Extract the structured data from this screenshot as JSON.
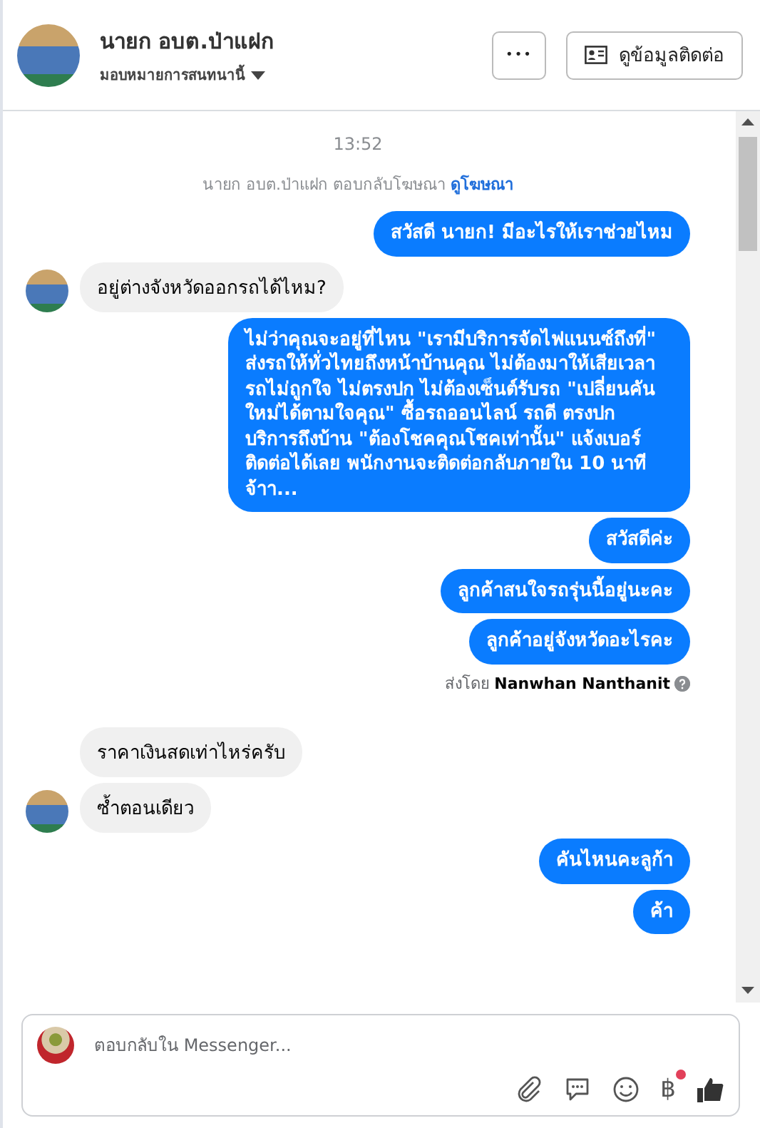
{
  "header": {
    "name": "นายก อบต.ป่าแฝก",
    "subtitle": "มอบหมายการสนทนานี้",
    "more_button": "•••",
    "contact_button": "ดูข้อมูลติดต่อ"
  },
  "messages": [
    {
      "kind": "timestamp",
      "text": "13:52"
    },
    {
      "kind": "notice",
      "text": "นายก อบต.ป่าแฝก ตอบกลับโฆษณา",
      "link": "ดูโฆษณา"
    },
    {
      "kind": "outgoing",
      "text": "สวัสดี นายก! มีอะไรให้เราช่วยไหม"
    },
    {
      "kind": "incoming",
      "text": "อยู่ต่างจังหวัดออกรถได้ไหม?",
      "avatar": true
    },
    {
      "kind": "outgoing",
      "text": "ไม่ว่าคุณจะอยู่ที่ไหน \"เรามีบริการจัดไฟแนนซ์ถึงที่\" ส่งรถให้ทั่วไทยถึงหน้าบ้านคุณ ไม่ต้องมาให้เสียเวลา รถไม่ถูกใจ ไม่ตรงปก ไม่ต้องเซ็นต์รับรถ \"เปลี่ยนคันใหม่ได้ตามใจคุณ\" ซื้อรถออนไลน์ รถดี ตรงปก บริการถึงบ้าน \"ต้องโชคคุณโชคเท่านั้น\" แจ้งเบอร์ ติดต่อได้เลย พนักงานจะติดต่อกลับภายใน 10 นาที จ้าา..."
    },
    {
      "kind": "outgoing",
      "text": "สวัสดีค่ะ"
    },
    {
      "kind": "outgoing",
      "text": "ลูกค้าสนใจรถรุ่นนี้อยู่นะคะ"
    },
    {
      "kind": "outgoing",
      "text": "ลูกค้าอยู่จังหวัดอะไรคะ"
    },
    {
      "kind": "sent_by",
      "text": "ส่งโดย",
      "sender": "Nanwhan Nanthanit"
    },
    {
      "kind": "incoming",
      "text": "ราคาเงินสดเท่าไหร่ครับ",
      "avatar": false
    },
    {
      "kind": "incoming",
      "text": "ซ้ำตอนเดียว",
      "avatar": true
    },
    {
      "kind": "outgoing",
      "text": "คันไหนคะลูก้า"
    },
    {
      "kind": "outgoing",
      "text": "ค้า"
    }
  ],
  "composer": {
    "placeholder": "ตอบกลับใน Messenger...",
    "baht": "฿"
  }
}
